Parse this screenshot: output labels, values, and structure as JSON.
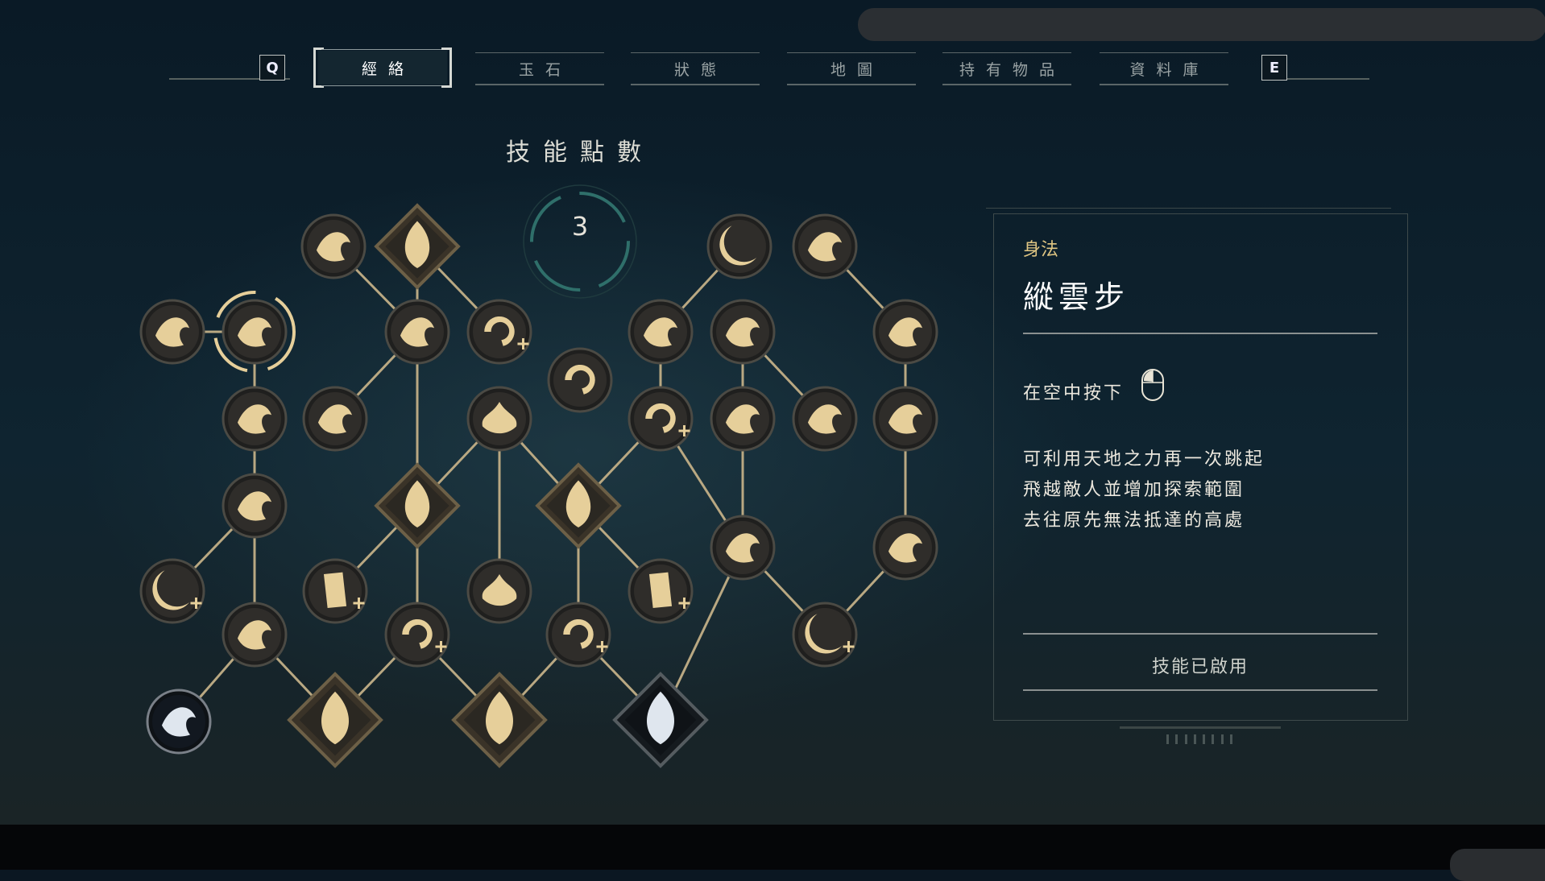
{
  "tabs": {
    "left_key": "Q",
    "right_key": "E",
    "items": [
      {
        "label": "經絡",
        "active": true
      },
      {
        "label": "玉石",
        "active": false
      },
      {
        "label": "狀態",
        "active": false
      },
      {
        "label": "地圖",
        "active": false
      },
      {
        "label": "持有物品",
        "active": false
      },
      {
        "label": "資料庫",
        "active": false
      }
    ]
  },
  "skill_points": {
    "title": "技能點數",
    "value": "3"
  },
  "skill_tree": {
    "nodes": [
      {
        "id": "n01",
        "shape": "circle",
        "icon": "wind-cloud-icon",
        "state": "unlocked"
      },
      {
        "id": "n02",
        "shape": "circle",
        "icon": "leaping-figure-icon",
        "state": "selected"
      },
      {
        "id": "n03",
        "shape": "circle",
        "icon": "wind-bird-icon",
        "state": "unlocked"
      },
      {
        "id": "n04",
        "shape": "diamond",
        "icon": "flame-palm-icon",
        "state": "unlocked"
      },
      {
        "id": "n05",
        "shape": "circle",
        "icon": "flying-bird-icon",
        "state": "unlocked"
      },
      {
        "id": "n06",
        "shape": "circle",
        "icon": "spin-plus-icon",
        "state": "unlocked"
      },
      {
        "id": "n07",
        "shape": "circle",
        "icon": "sword-spin-icon",
        "state": "unlocked"
      },
      {
        "id": "n08",
        "shape": "circle",
        "icon": "crescent-icon",
        "state": "unlocked"
      },
      {
        "id": "n09",
        "shape": "circle",
        "icon": "dragon-claw-icon",
        "state": "unlocked"
      },
      {
        "id": "n10",
        "shape": "circle",
        "icon": "lightning-strike-icon",
        "state": "unlocked"
      },
      {
        "id": "n11",
        "shape": "circle",
        "icon": "blossom-strike-icon",
        "state": "unlocked"
      },
      {
        "id": "n12",
        "shape": "circle",
        "icon": "claw-slash-icon",
        "state": "unlocked"
      },
      {
        "id": "n13",
        "shape": "circle",
        "icon": "monkey-icon",
        "state": "unlocked"
      },
      {
        "id": "n14",
        "shape": "circle",
        "icon": "bird-dive-icon",
        "state": "unlocked"
      },
      {
        "id": "n15",
        "shape": "circle",
        "icon": "lotus-icon",
        "state": "unlocked"
      },
      {
        "id": "n16",
        "shape": "circle",
        "icon": "spin-plus-icon",
        "state": "unlocked"
      },
      {
        "id": "n17",
        "shape": "circle",
        "icon": "burst-icon",
        "state": "unlocked"
      },
      {
        "id": "n18",
        "shape": "circle",
        "icon": "kick-icon",
        "state": "unlocked"
      },
      {
        "id": "n19",
        "shape": "circle",
        "icon": "swirl-claw-icon",
        "state": "unlocked"
      },
      {
        "id": "n20",
        "shape": "circle",
        "icon": "monkey-leap-icon",
        "state": "unlocked"
      },
      {
        "id": "n21",
        "shape": "diamond",
        "icon": "flame-palm-icon",
        "state": "unlocked"
      },
      {
        "id": "n22",
        "shape": "diamond",
        "icon": "flame-palm-icon",
        "state": "unlocked"
      },
      {
        "id": "n23",
        "shape": "circle",
        "icon": "crescent-plus-icon",
        "state": "unlocked"
      },
      {
        "id": "n24",
        "shape": "circle",
        "icon": "talisman-plus-icon",
        "state": "unlocked"
      },
      {
        "id": "n25",
        "shape": "circle",
        "icon": "lotus-icon",
        "state": "unlocked"
      },
      {
        "id": "n26",
        "shape": "circle",
        "icon": "talisman-plus-icon",
        "state": "unlocked"
      },
      {
        "id": "n27",
        "shape": "circle",
        "icon": "whirl-burst-icon",
        "state": "unlocked"
      },
      {
        "id": "n28",
        "shape": "circle",
        "icon": "claw-slash-icon",
        "state": "unlocked"
      },
      {
        "id": "n29",
        "shape": "circle",
        "icon": "monkey-icon",
        "state": "unlocked"
      },
      {
        "id": "n30",
        "shape": "circle",
        "icon": "spin-plus-icon",
        "state": "unlocked"
      },
      {
        "id": "n31",
        "shape": "circle",
        "icon": "spin-plus-icon",
        "state": "unlocked"
      },
      {
        "id": "n32",
        "shape": "circle",
        "icon": "crescent-plus-icon",
        "state": "unlocked"
      },
      {
        "id": "n33",
        "shape": "circle",
        "icon": "swirl-emblem-icon",
        "state": "locked"
      },
      {
        "id": "n34",
        "shape": "diamond",
        "icon": "flame-palm-icon",
        "state": "unlocked"
      },
      {
        "id": "n35",
        "shape": "diamond",
        "icon": "flame-palm-icon",
        "state": "unlocked"
      },
      {
        "id": "n36",
        "shape": "diamond",
        "icon": "flame-palm-icon",
        "state": "locked"
      }
    ],
    "links": [
      [
        "n01",
        "n02"
      ],
      [
        "n02",
        "n13"
      ],
      [
        "n13",
        "n20"
      ],
      [
        "n20",
        "n23"
      ],
      [
        "n20",
        "n29"
      ],
      [
        "n29",
        "n33"
      ],
      [
        "n29",
        "n34"
      ],
      [
        "n03",
        "n05"
      ],
      [
        "n04",
        "n05"
      ],
      [
        "n04",
        "n06"
      ],
      [
        "n05",
        "n14"
      ],
      [
        "n05",
        "n21"
      ],
      [
        "n21",
        "n24"
      ],
      [
        "n21",
        "n30"
      ],
      [
        "n34",
        "n30"
      ],
      [
        "n30",
        "n35"
      ],
      [
        "n15",
        "n21"
      ],
      [
        "n15",
        "n22"
      ],
      [
        "n15",
        "n25"
      ],
      [
        "n22",
        "n31"
      ],
      [
        "n22",
        "n26"
      ],
      [
        "n31",
        "n35"
      ],
      [
        "n31",
        "n36"
      ],
      [
        "n08",
        "n10"
      ],
      [
        "n10",
        "n16"
      ],
      [
        "n16",
        "n22"
      ],
      [
        "n16",
        "n27"
      ],
      [
        "n11",
        "n17"
      ],
      [
        "n11",
        "n18"
      ],
      [
        "n17",
        "n27"
      ],
      [
        "n27",
        "n32"
      ],
      [
        "n27",
        "n36"
      ],
      [
        "n09",
        "n12"
      ],
      [
        "n12",
        "n19"
      ],
      [
        "n19",
        "n28"
      ],
      [
        "n28",
        "n32"
      ]
    ]
  },
  "detail": {
    "category": "身法",
    "name": "縱雲步",
    "hint": "在空中按下",
    "hint_icon": "mouse-left-click-icon",
    "description": [
      "可利用天地之力再一次跳起",
      "飛越敵人並增加探索範圍",
      "去往原先無法抵達的高處"
    ],
    "status": "技能已啟用"
  },
  "colors": {
    "accent_gold": "#e0c683",
    "node_fill": "#2f2d2a",
    "node_icon": "#e6cf9a",
    "link": "#b9a882",
    "ring": "#2f6f6a",
    "locked_icon": "#dfe6ee"
  }
}
